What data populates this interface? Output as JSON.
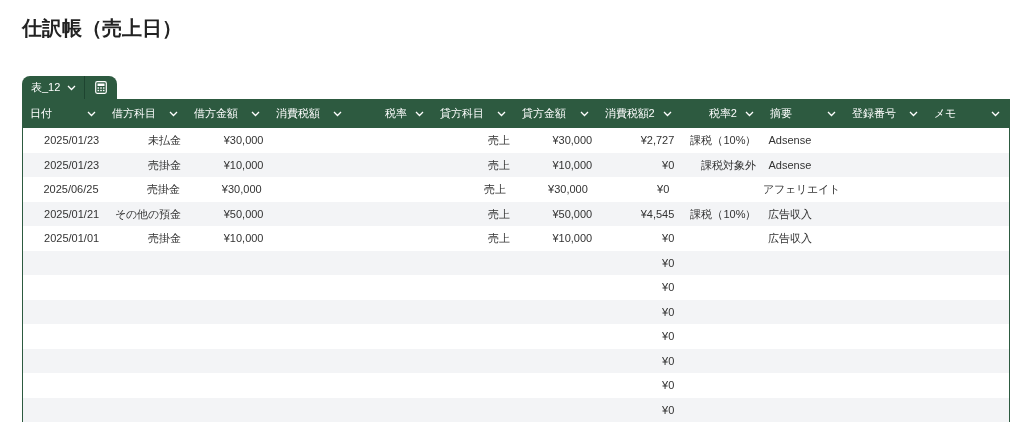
{
  "title": "仕訳帳（売上日）",
  "table_tab": {
    "label": "表_12"
  },
  "columns": [
    "日付",
    "借方科目",
    "借方金額",
    "消費税額",
    "税率",
    "貸方科目",
    "貸方金額",
    "消費税額2",
    "税率2",
    "摘要",
    "登録番号",
    "メモ"
  ],
  "rows": [
    [
      "2025/01/23",
      "未払金",
      "¥30,000",
      null,
      null,
      "売上",
      "¥30,000",
      "¥2,727",
      "課税（10%）",
      "Adsense",
      null,
      null
    ],
    [
      "2025/01/23",
      "売掛金",
      "¥10,000",
      null,
      null,
      "売上",
      "¥10,000",
      "¥0",
      "課税対象外",
      "Adsense",
      null,
      null
    ],
    [
      "2025/06/25",
      "売掛金",
      "¥30,000",
      null,
      null,
      "売上",
      "¥30,000",
      "¥0",
      null,
      "アフェリエイト",
      null,
      null
    ],
    [
      "2025/01/21",
      "その他の預金",
      "¥50,000",
      null,
      null,
      "売上",
      "¥50,000",
      "¥4,545",
      "課税（10%）",
      "広告収入",
      null,
      null
    ],
    [
      "2025/01/01",
      "売掛金",
      "¥10,000",
      null,
      null,
      "売上",
      "¥10,000",
      "¥0",
      null,
      "広告収入",
      null,
      null
    ],
    [
      null,
      null,
      null,
      null,
      null,
      null,
      null,
      "¥0",
      null,
      null,
      null,
      null
    ],
    [
      null,
      null,
      null,
      null,
      null,
      null,
      null,
      "¥0",
      null,
      null,
      null,
      null
    ],
    [
      null,
      null,
      null,
      null,
      null,
      null,
      null,
      "¥0",
      null,
      null,
      null,
      null
    ],
    [
      null,
      null,
      null,
      null,
      null,
      null,
      null,
      "¥0",
      null,
      null,
      null,
      null
    ],
    [
      null,
      null,
      null,
      null,
      null,
      null,
      null,
      "¥0",
      null,
      null,
      null,
      null
    ],
    [
      null,
      null,
      null,
      null,
      null,
      null,
      null,
      "¥0",
      null,
      null,
      null,
      null
    ],
    [
      null,
      null,
      null,
      null,
      null,
      null,
      null,
      "¥0",
      null,
      null,
      null,
      null
    ]
  ]
}
